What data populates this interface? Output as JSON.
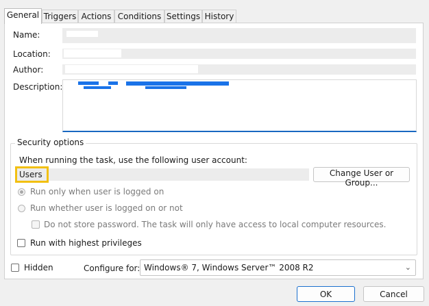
{
  "tabs": [
    {
      "label": "General",
      "active": true
    },
    {
      "label": "Triggers"
    },
    {
      "label": "Actions"
    },
    {
      "label": "Conditions"
    },
    {
      "label": "Settings"
    },
    {
      "label": "History"
    }
  ],
  "fields": {
    "name_label": "Name:",
    "location_label": "Location:",
    "author_label": "Author:",
    "description_label": "Description:"
  },
  "security": {
    "group_title": "Security options",
    "account_prompt": "When running the task, use the following user account:",
    "user_account": "Users",
    "change_button": "Change User or Group...",
    "radio_logged_on": "Run only when user is logged on",
    "radio_whether": "Run whether user is logged on or not",
    "no_store_password": "Do not store password.  The task will only have access to local computer resources.",
    "highest_privileges": "Run with highest privileges"
  },
  "footer": {
    "hidden_label": "Hidden",
    "configure_label": "Configure for:",
    "configure_value": "Windows® 7, Windows Server™ 2008 R2",
    "ok_button": "OK",
    "cancel_button": "Cancel"
  },
  "colors": {
    "accent": "#1867c0",
    "highlight": "#f2c012"
  }
}
